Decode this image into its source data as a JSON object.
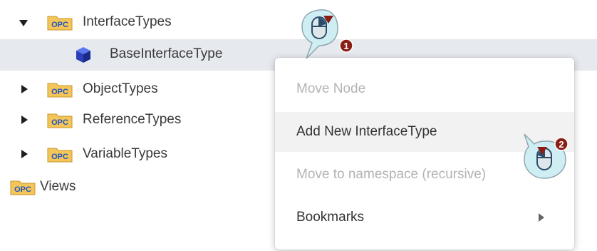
{
  "tree": {
    "items": [
      {
        "label": "InterfaceTypes",
        "icon": "opc-folder-icon",
        "expanded": true
      },
      {
        "label": "BaseInterfaceType",
        "icon": "interface-type-icon",
        "selected": true
      },
      {
        "label": "ObjectTypes",
        "icon": "opc-folder-icon",
        "expanded": false
      },
      {
        "label": "ReferenceTypes",
        "icon": "opc-folder-icon",
        "expanded": false
      },
      {
        "label": "VariableTypes",
        "icon": "opc-folder-icon",
        "expanded": false
      },
      {
        "label": "Views",
        "icon": "opc-folder-icon"
      }
    ],
    "folder_badge": "OPC"
  },
  "context_menu": {
    "items": [
      {
        "label": "Move Node",
        "disabled": true
      },
      {
        "label": "Add New InterfaceType",
        "disabled": false,
        "hovered": true
      },
      {
        "label": "Move to namespace (recursive)",
        "disabled": true
      },
      {
        "label": "Bookmarks",
        "disabled": false,
        "has_submenu": true
      }
    ]
  },
  "callouts": [
    {
      "step": "1",
      "action": "right-click"
    },
    {
      "step": "2",
      "action": "left-click"
    }
  ],
  "colors": {
    "folder": "#f4c65a",
    "folder_badge_text": "#2255bb",
    "selected_row": "#e6e9ee",
    "callout_fill": "#cfeef3",
    "callout_badge": "#8b1e14"
  }
}
